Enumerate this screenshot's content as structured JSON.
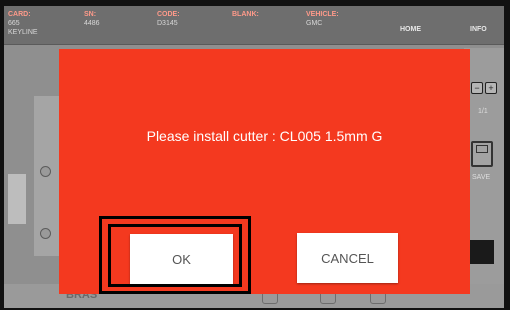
{
  "topbar": {
    "columns": [
      {
        "head": "CARD:",
        "l1": "665",
        "l2": "KEYLINE"
      },
      {
        "head": "SN:",
        "l1": "4486",
        "l2": ""
      },
      {
        "head": "CODE:",
        "l1": "D3145",
        "l2": ""
      },
      {
        "head": "BLANK:",
        "l1": "",
        "l2": ""
      },
      {
        "head": "VEHICLE:",
        "l1": "GMC",
        "l2": ""
      }
    ],
    "home": "HOME",
    "info": "INFO"
  },
  "right_panel": {
    "minus": "−",
    "plus": "+",
    "page": "1/1",
    "save": "SAVE"
  },
  "bottom": {
    "label": "BRAS"
  },
  "dialog": {
    "message": "Please install cutter : CL005 1.5mm G",
    "ok": "OK",
    "cancel": "CANCEL",
    "bg_color": "#f4391f"
  }
}
